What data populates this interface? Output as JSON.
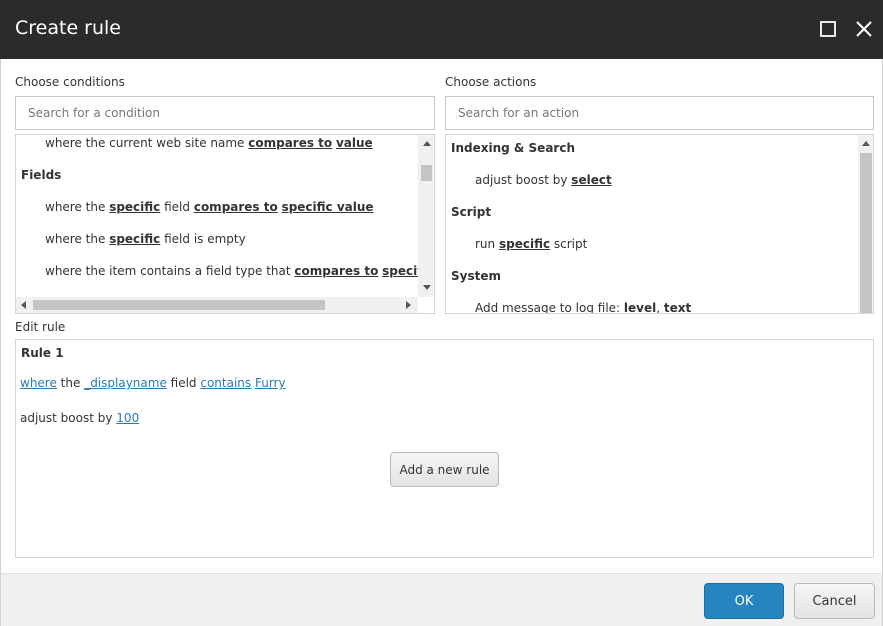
{
  "dialog": {
    "title": "Create rule",
    "maximize_icon": "maximize-icon",
    "close_icon": "close-icon"
  },
  "conditions": {
    "label": "Choose conditions",
    "search_placeholder": "Search for a condition",
    "items": [
      {
        "type": "item",
        "parts": [
          {
            "t": "where the current web site name ",
            "link": false
          },
          {
            "t": "compares to",
            "link": true
          },
          {
            "t": " ",
            "link": false
          },
          {
            "t": "value",
            "link": true
          }
        ]
      },
      {
        "type": "heading",
        "text": "Fields"
      },
      {
        "type": "item",
        "parts": [
          {
            "t": "where the ",
            "link": false
          },
          {
            "t": "specific",
            "link": true
          },
          {
            "t": " field ",
            "link": false
          },
          {
            "t": "compares to",
            "link": true
          },
          {
            "t": " ",
            "link": false
          },
          {
            "t": "specific value",
            "link": true
          }
        ]
      },
      {
        "type": "item",
        "parts": [
          {
            "t": "where the ",
            "link": false
          },
          {
            "t": "specific",
            "link": true
          },
          {
            "t": " field is empty",
            "link": false
          }
        ]
      },
      {
        "type": "item",
        "parts": [
          {
            "t": "where the item contains a field type that ",
            "link": false
          },
          {
            "t": "compares to",
            "link": true
          },
          {
            "t": " ",
            "link": false
          },
          {
            "t": "specific",
            "link": true
          }
        ]
      }
    ]
  },
  "actions": {
    "label": "Choose actions",
    "search_placeholder": "Search for an action",
    "items": [
      {
        "type": "heading",
        "text": "Indexing & Search"
      },
      {
        "type": "item",
        "parts": [
          {
            "t": "adjust boost by ",
            "link": false
          },
          {
            "t": "select",
            "link": true
          }
        ]
      },
      {
        "type": "heading",
        "text": "Script"
      },
      {
        "type": "item",
        "parts": [
          {
            "t": "run ",
            "link": false
          },
          {
            "t": "specific",
            "link": true
          },
          {
            "t": " script",
            "link": false
          }
        ]
      },
      {
        "type": "heading",
        "text": "System"
      },
      {
        "type": "item",
        "parts": [
          {
            "t": "Add message to log file: ",
            "link": false
          },
          {
            "t": "level",
            "link": true
          },
          {
            "t": ", ",
            "link": false
          },
          {
            "t": "text",
            "link": true
          }
        ]
      }
    ]
  },
  "edit_rule": {
    "label": "Edit rule",
    "rule_title": "Rule 1",
    "condition": {
      "where": "where",
      "the": " the ",
      "field_name": "_displayname",
      "field": " field ",
      "operator": "contains",
      "space": " ",
      "value": "Furry"
    },
    "action": {
      "text": "adjust boost by ",
      "value": "100"
    },
    "add_rule_label": "Add a new rule"
  },
  "footer": {
    "ok_label": "OK",
    "cancel_label": "Cancel"
  },
  "colors": {
    "titlebar": "#2b2b2b",
    "link_blue": "#2a7ab0",
    "ok_blue": "#2585bf",
    "footer_bg": "#f0f0f0"
  }
}
